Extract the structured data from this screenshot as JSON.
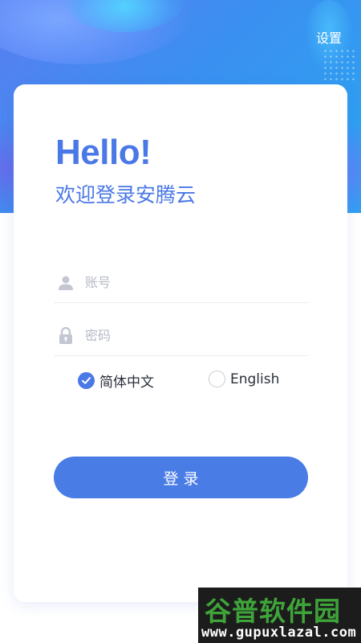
{
  "header": {
    "settings_label": "设置"
  },
  "login": {
    "greeting": "Hello!",
    "welcome": "欢迎登录安腾云",
    "account_placeholder": "账号",
    "password_placeholder": "密码",
    "language_options": [
      {
        "label": "简体中文",
        "selected": true
      },
      {
        "label": "English",
        "selected": false
      }
    ],
    "submit_label": "登录"
  },
  "watermark": {
    "title": "谷普软件园",
    "url": "www.gupuxlazal.com"
  },
  "colors": {
    "accent": "#4a78e6",
    "button": "#4a7ce6",
    "header_gradient_start": "#5a7ef0",
    "header_gradient_end": "#2aa6f2",
    "placeholder": "#b6bbc6"
  },
  "icons": {
    "account": "user-icon",
    "password": "lock-icon",
    "selected_radio": "check-icon"
  }
}
